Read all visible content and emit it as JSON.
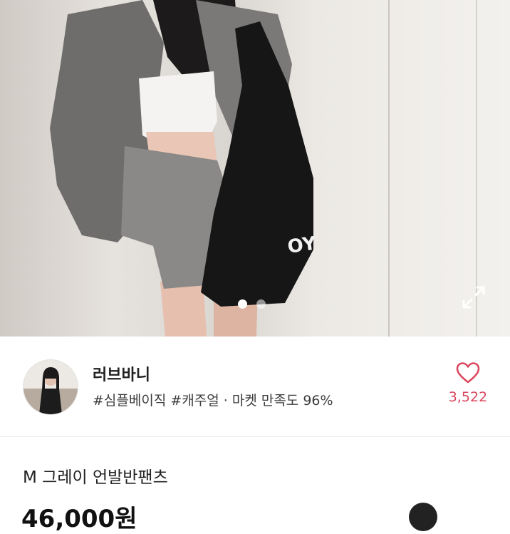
{
  "photo": {
    "alt": "product photo",
    "image_count": 2,
    "active_index": 1
  },
  "icons": {
    "expand": "expand-icon",
    "heart": "heart-outline-icon"
  },
  "seller": {
    "name": "러브바니",
    "meta": "#심플베이직 #캐주얼 · 마켓 만족도 96%",
    "likes": "3,522"
  },
  "product": {
    "title": "M 그레이 언발반팬츠",
    "price": "46,000원"
  },
  "colors": {
    "accent": "#d9455c",
    "text": "#222222"
  }
}
